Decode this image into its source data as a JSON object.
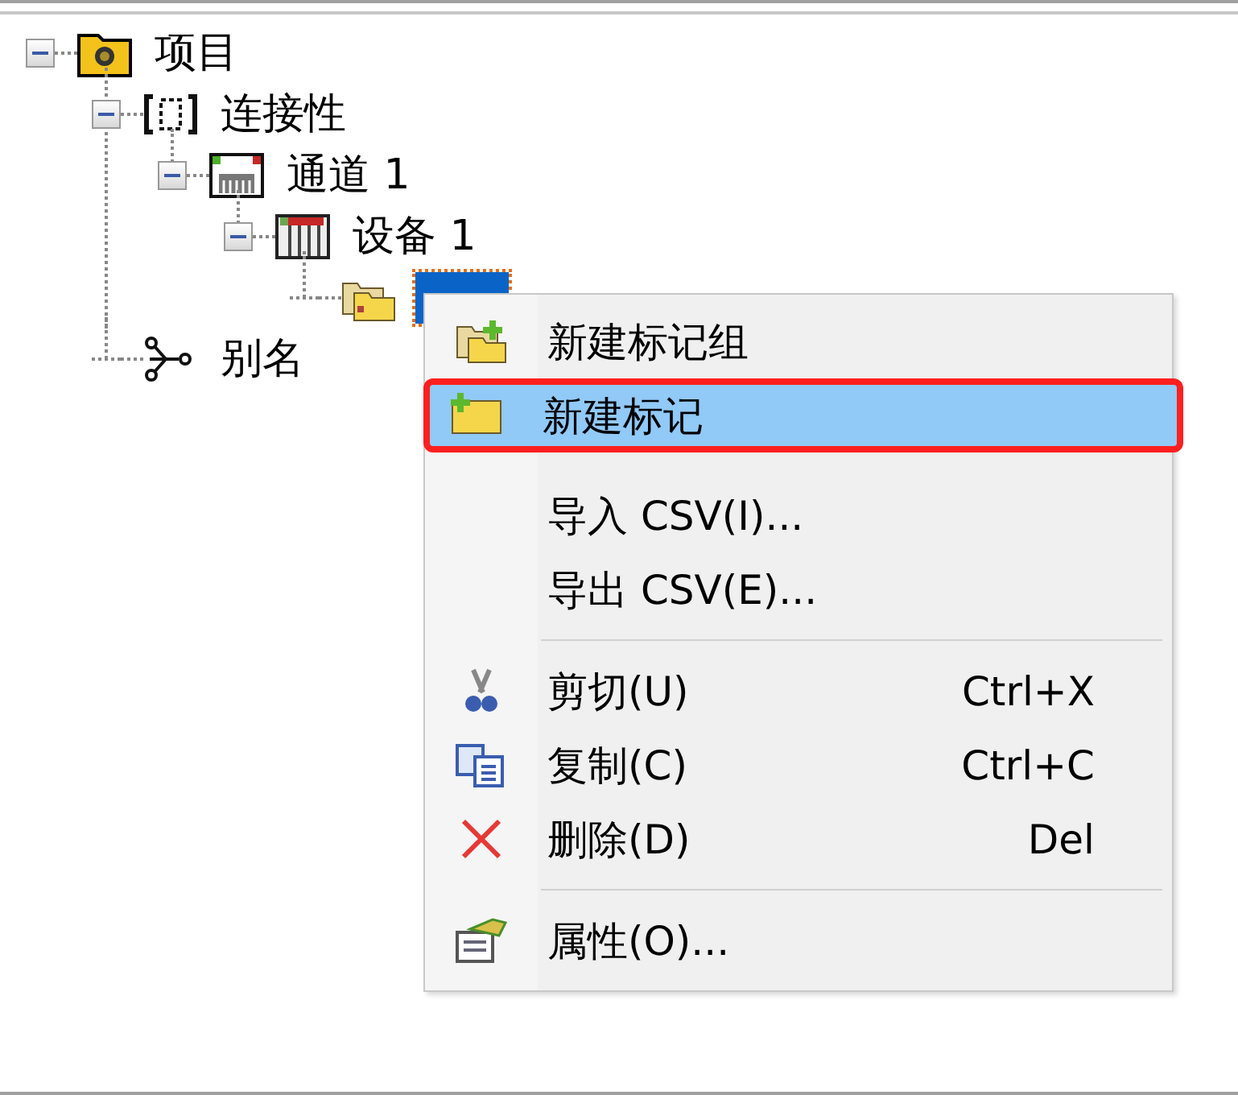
{
  "tree": [
    {
      "label": "项目",
      "kind": "project",
      "expanded": true,
      "selected": false,
      "children": [
        {
          "label": "连接性",
          "kind": "connectivity",
          "expanded": true,
          "selected": false,
          "children": [
            {
              "label": "通道 1",
              "kind": "channel",
              "expanded": true,
              "selected": false,
              "children": [
                {
                  "label": "设备 1",
                  "kind": "device",
                  "expanded": true,
                  "selected": false,
                  "children": [
                    {
                      "kind": "group",
                      "selected": true
                    }
                  ]
                }
              ]
            }
          ]
        },
        {
          "label": "别名",
          "kind": "alias",
          "selected": false
        }
      ]
    }
  ],
  "context_menu": {
    "items": [
      {
        "kind": "item",
        "label": "新建标记组",
        "selected": false
      },
      {
        "kind": "item",
        "label": "新建标记",
        "selected": true
      },
      {
        "kind": "spacer"
      },
      {
        "kind": "item",
        "label": "导入 CSV(I)...",
        "selected": false
      },
      {
        "kind": "item",
        "label": "导出 CSV(E)...",
        "selected": false
      },
      {
        "kind": "separator"
      },
      {
        "kind": "item",
        "label": "剪切(U)",
        "shortcut": "Ctrl+X",
        "selected": false
      },
      {
        "kind": "item",
        "label": "复制(C)",
        "shortcut": "Ctrl+C",
        "selected": false
      },
      {
        "kind": "item",
        "label": "删除(D)",
        "shortcut": "Del",
        "selected": false
      },
      {
        "kind": "separator"
      },
      {
        "kind": "item",
        "label": "属性(O)...",
        "selected": false
      }
    ]
  }
}
